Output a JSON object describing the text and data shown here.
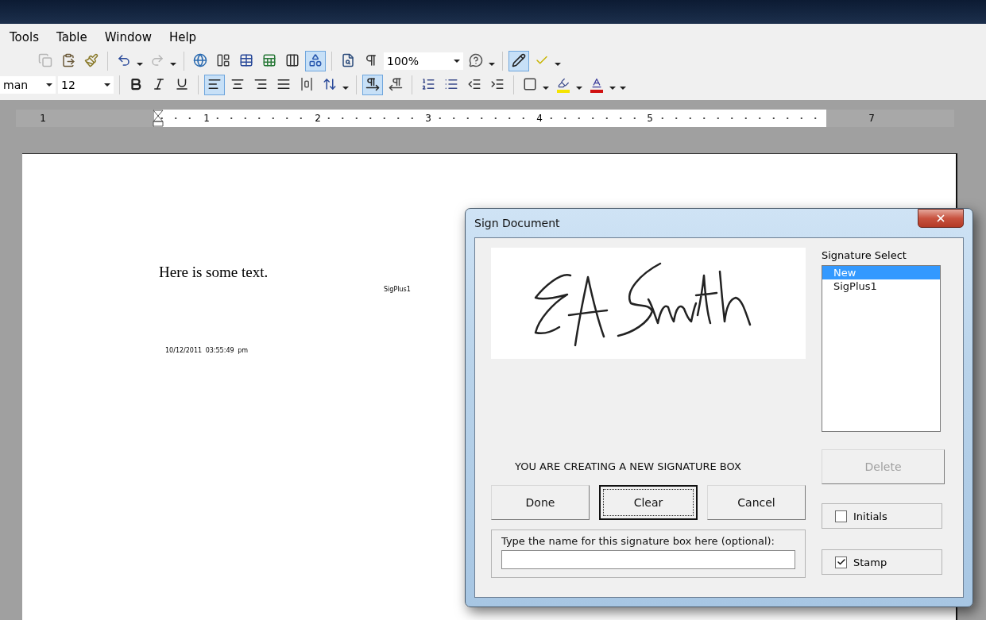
{
  "menu_bar": {
    "items": [
      "Tools",
      "Table",
      "Window",
      "Help"
    ]
  },
  "toolbars": [
    {
      "items": [
        {
          "kind": "copy",
          "pressed": false,
          "disabled": true
        },
        {
          "kind": "paste",
          "pressed": false,
          "disabled": false
        },
        {
          "kind": "painter",
          "pressed": false,
          "disabled": false
        },
        {
          "kind": "separator"
        },
        {
          "kind": "undo",
          "pressed": false,
          "disabled": false
        },
        {
          "kind": "dropdown"
        },
        {
          "kind": "redo",
          "pressed": false,
          "disabled": true
        },
        {
          "kind": "dropdown"
        },
        {
          "kind": "separator"
        },
        {
          "kind": "globe",
          "pressed": false,
          "disabled": false
        },
        {
          "kind": "tableborders",
          "pressed": false,
          "disabled": false
        },
        {
          "kind": "table",
          "pressed": false,
          "disabled": false
        },
        {
          "kind": "sheet",
          "pressed": false,
          "disabled": false
        },
        {
          "kind": "columns",
          "pressed": false,
          "disabled": false
        },
        {
          "kind": "shapes",
          "pressed": true,
          "disabled": false
        },
        {
          "kind": "separator"
        },
        {
          "kind": "docmap",
          "pressed": false,
          "disabled": false
        },
        {
          "kind": "pilcrow",
          "pressed": false,
          "disabled": false
        },
        {
          "kind": "combo",
          "value": "100%"
        },
        {
          "kind": "help",
          "pressed": false,
          "disabled": false
        },
        {
          "kind": "dropdown"
        },
        {
          "kind": "separator"
        },
        {
          "kind": "pencil",
          "pressed": true,
          "disabled": false
        },
        {
          "kind": "check",
          "pressed": false,
          "disabled": false
        },
        {
          "kind": "dropdown"
        }
      ]
    },
    {
      "items": [
        {
          "kind": "combo",
          "value": "man"
        },
        {
          "kind": "combo",
          "value": "12"
        },
        {
          "kind": "separator"
        },
        {
          "kind": "bold",
          "pressed": false,
          "disabled": false
        },
        {
          "kind": "italic",
          "pressed": false,
          "disabled": false
        },
        {
          "kind": "underline",
          "pressed": false,
          "disabled": false
        },
        {
          "kind": "separator"
        },
        {
          "kind": "alignleft",
          "pressed": true,
          "disabled": false
        },
        {
          "kind": "aligncenter",
          "pressed": false,
          "disabled": false
        },
        {
          "kind": "alignright",
          "pressed": false,
          "disabled": false
        },
        {
          "kind": "justify",
          "pressed": false,
          "disabled": false
        },
        {
          "kind": "distribute",
          "pressed": false,
          "disabled": false
        },
        {
          "kind": "linespacing",
          "pressed": false,
          "disabled": false
        },
        {
          "kind": "dropdown"
        },
        {
          "kind": "separator"
        },
        {
          "kind": "ltr",
          "pressed": true,
          "disabled": false
        },
        {
          "kind": "rtl",
          "pressed": false,
          "disabled": false
        },
        {
          "kind": "separator"
        },
        {
          "kind": "numbered",
          "pressed": false,
          "disabled": false
        },
        {
          "kind": "bullets",
          "pressed": false,
          "disabled": false
        },
        {
          "kind": "outdent",
          "pressed": false,
          "disabled": false
        },
        {
          "kind": "indent",
          "pressed": false,
          "disabled": false
        },
        {
          "kind": "separator"
        },
        {
          "kind": "border",
          "pressed": false,
          "disabled": false
        },
        {
          "kind": "dropdown"
        },
        {
          "kind": "highlight",
          "pressed": false,
          "disabled": false
        },
        {
          "kind": "dropdown"
        },
        {
          "kind": "fontcolor",
          "pressed": false,
          "disabled": false
        },
        {
          "kind": "dropdown"
        },
        {
          "kind": "dropdown"
        }
      ]
    }
  ],
  "ruler": {
    "labels": [
      "1",
      "1",
      "2",
      "3",
      "4",
      "5",
      "7"
    ]
  },
  "document": {
    "body_text": "Here is some text.",
    "signature_label": "SigPlus1",
    "timestamp": "10/12/2011  03:55:49 pm"
  },
  "dialog": {
    "title": "Sign Document",
    "signature_select": {
      "label": "Signature Select",
      "items": [
        {
          "label": "New",
          "selected": true
        },
        {
          "label": "SigPlus1",
          "selected": false
        }
      ]
    },
    "delete_button": {
      "label": "Delete",
      "disabled": true
    },
    "options": [
      {
        "label": "Initials",
        "checked": false
      },
      {
        "label": "Stamp",
        "checked": true
      }
    ],
    "message": "YOU ARE CREATING A NEW SIGNATURE BOX",
    "buttons": [
      {
        "label": "Done",
        "focused": false
      },
      {
        "label": "Clear",
        "focused": true
      },
      {
        "label": "Cancel",
        "focused": false
      }
    ],
    "name_field": {
      "label": "Type the name for this signature box here (optional):"
    }
  }
}
